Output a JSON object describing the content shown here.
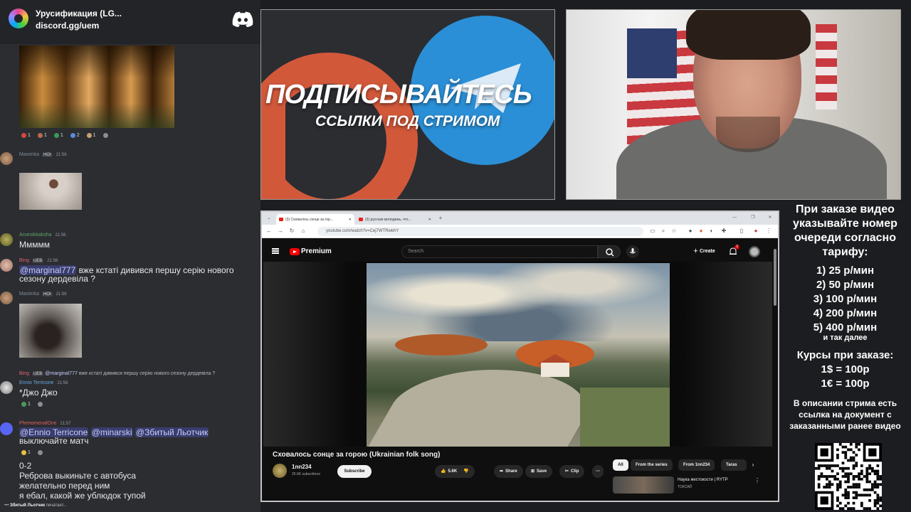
{
  "discord": {
    "server_title": "Урусификация (LG...",
    "invite": "discord.gg/uem",
    "messages": [
      {
        "id": "m1",
        "reactions": [
          {
            "count": "1"
          },
          {
            "count": "1"
          },
          {
            "count": "1"
          },
          {
            "count": "2"
          },
          {
            "count": "1"
          }
        ]
      },
      {
        "id": "m2",
        "author": "Maximka",
        "tag": "HOI",
        "time": "21:56"
      },
      {
        "id": "m3",
        "author": "Arsenikkaksha",
        "time": "21:56",
        "text": "Ммммм"
      },
      {
        "id": "m4",
        "author": "Bing",
        "tag": "UEB",
        "time": "21:56",
        "mention": "@marginal777",
        "text_line1": " вже кстаті дивився першу серію нового",
        "text_line2": "сезону дердевіла ?"
      },
      {
        "id": "m5",
        "author": "Maximka",
        "tag": "HOI",
        "time": "21:56"
      },
      {
        "id": "m6",
        "reply_author": "Bing",
        "reply_tag": "UEB",
        "reply_mention": "@marginal777",
        "reply_text": "вже кстаті дивився першу серію нового сезону дердевіла ?",
        "author": "Ennio Terricone",
        "time": "21:56",
        "text": "*Джо Джо",
        "reactions": [
          {
            "count": "1"
          },
          {
            "count": ""
          }
        ]
      },
      {
        "id": "m7",
        "author": "PhenomenalOne",
        "time": "21:57",
        "mention1": "@Ennio Terricone",
        "mention2": "@minarski",
        "mention3": "@Збитый Льотчик",
        "text": "выключайте матч",
        "reactions": [
          {
            "count": "1"
          },
          {
            "count": ""
          }
        ]
      },
      {
        "id": "m8",
        "line1": "0-2",
        "line2": "Реброва выкиньте с автобуса",
        "line3": "желательно перед ним",
        "line4": "я ебал, какой же ублюдок тупой"
      }
    ],
    "typing_user": "Збитый Льотчик",
    "typing_suffix": " печатает..."
  },
  "promo": {
    "title": "ПОДПИСЫВАЙТЕСЬ",
    "subtitle": "ССЫЛКИ ПОД СТРИМОМ"
  },
  "browser": {
    "tabs": [
      {
        "label": "(3) Сховалось сонце за гор..."
      },
      {
        "label": "(3) русская молодежь, что..."
      }
    ],
    "url": "youtube.com/watch?v=Cej7WTRwkhY",
    "yt": {
      "brand": "Premium",
      "search_placeholder": "Search",
      "create_label": "Create",
      "notif_count": "3",
      "video_title": "Сховалось сонце за горою (Ukrainian folk song)",
      "channel_name": "1nn234",
      "channel_subs": "25.6K subscribers",
      "subscribe_label": "Subscribe",
      "likes": "5.6K",
      "share_label": "Share",
      "save_label": "Save",
      "clip_label": "Clip",
      "chips": [
        "All",
        "From the series",
        "From 1nn234",
        "Taras"
      ],
      "rec_title": "Наука жестокости | RYTP",
      "rec_sub": "ТОКСАЙ"
    }
  },
  "info": {
    "header": "При заказе видео указывайте номер очереди согласно тарифу:",
    "prices": [
      "1) 25 р/мин",
      "2) 50 р/мин",
      "3) 100 р/мин",
      "4) 200 р/мин",
      "5) 400 р/мин"
    ],
    "more": "и так далее",
    "rates_header": "Курсы при заказе:",
    "rates": [
      "1$ = 100р",
      "1€ = 100р"
    ],
    "doc_note": "В описании стрима есть ссылка на документ с заказанными ранее видео"
  },
  "colors": {
    "discord_bg": "#2b2d31",
    "mention_bg": "#5865f2",
    "patreon": "#d2583a",
    "telegram": "#2a8fd6",
    "yt_red": "#ff0000"
  }
}
